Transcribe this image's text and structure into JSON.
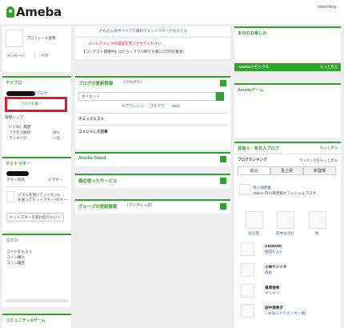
{
  "header": {
    "logo_text": "Ameba",
    "user_id": "totoricking"
  },
  "left": {
    "profile_label": "プロフィール画像",
    "message_label": "メッセージ",
    "pets_label": "ペタ",
    "ameblo_title": "アメブロ",
    "my_blog_label": "のブログ",
    "write_blog_button": "ブログを書く",
    "manage_top": "管理トップ",
    "stats_rows": [
      {
        "label": "いいね！履歴",
        "value": ""
      },
      {
        "label": "アクセス解析",
        "value": "0PV"
      },
      {
        "label": "ランキング",
        "value": "一位"
      }
    ],
    "dotmoney_title": "ドットマネー",
    "money_owned_label": "マネー残高",
    "money_owned_value": "0 マネー",
    "puzzle_text": "パズルを頂いてインセン",
    "puzzle_sub": "を送ってドットマネーへ",
    "puzzle_plus": "+1",
    "puzzle_unit": "マネー",
    "dotmoney_button": "ドットマネーを受け取りにいく",
    "coin_title": "コイン",
    "coin_items": [
      "コインをもらう",
      "コイン購入",
      "コイン履歴"
    ],
    "community_title": "コミュニティ&ゲーム"
  },
  "mid": {
    "campaign_link": "かんたん条件クリアで無料でドットマネーがもらえる",
    "email_alert": "メールアドレスの認証を完了させてください",
    "contest_notice": "【コンテスト開催中】はたらくママ川柳で大賞に1万円の賞金！",
    "blog_updates_title": "ブログの更新情報",
    "blog_updates_sub": "［つながり］",
    "diet_input": "ダイエット",
    "tags": [
      "ヘアアレンジ",
      "プチプラ",
      "BBQ"
    ],
    "checklist_label": "チェックリスト",
    "commented_label": "コメントした記事",
    "ownd_title": "Ameba Ownd",
    "recent_services_title": "最近使ったサービス",
    "group_updates_title": "グループの更新情報",
    "group_updates_sub": "［マイグルっぽ］"
  },
  "right": {
    "today_title": "本日のお楽しみ",
    "ameba_topics_title": "Amebaトピックス",
    "ameba_topics_more": "もっと見る",
    "ameba_game_title": "Amebaゲーム",
    "celebrity_title": "芸能人・有名人ブログ",
    "celebrity_more": "もっと見る",
    "ranking_title": "ブログランキング",
    "ranking_more": "ランキングをもっと見る",
    "ranking_tabs": [
      "総合",
      "急上昇",
      "新登場"
    ],
    "celeb_card_name": "市川海老蔵",
    "celeb_card_desc": "ABKAI 市川海老蔵オフィシャルブログ",
    "celeb_names": [
      "北斗晶",
      "鈴木おさむ",
      "桃"
    ],
    "list": [
      {
        "name": "GENKING",
        "sub": "侶遊たん!!"
      },
      {
        "name": "小林ケンイチ",
        "sub": "再会"
      },
      {
        "name": "東原亜希",
        "sub": "ギリギリ"
      },
      {
        "name": "田中亜希子",
        "sub": "☆お気に入りカンカン帽☆"
      }
    ]
  },
  "colors": {
    "accent": "#2ea32e",
    "alert": "#d0021b",
    "highlight_box": "#e01b24"
  }
}
